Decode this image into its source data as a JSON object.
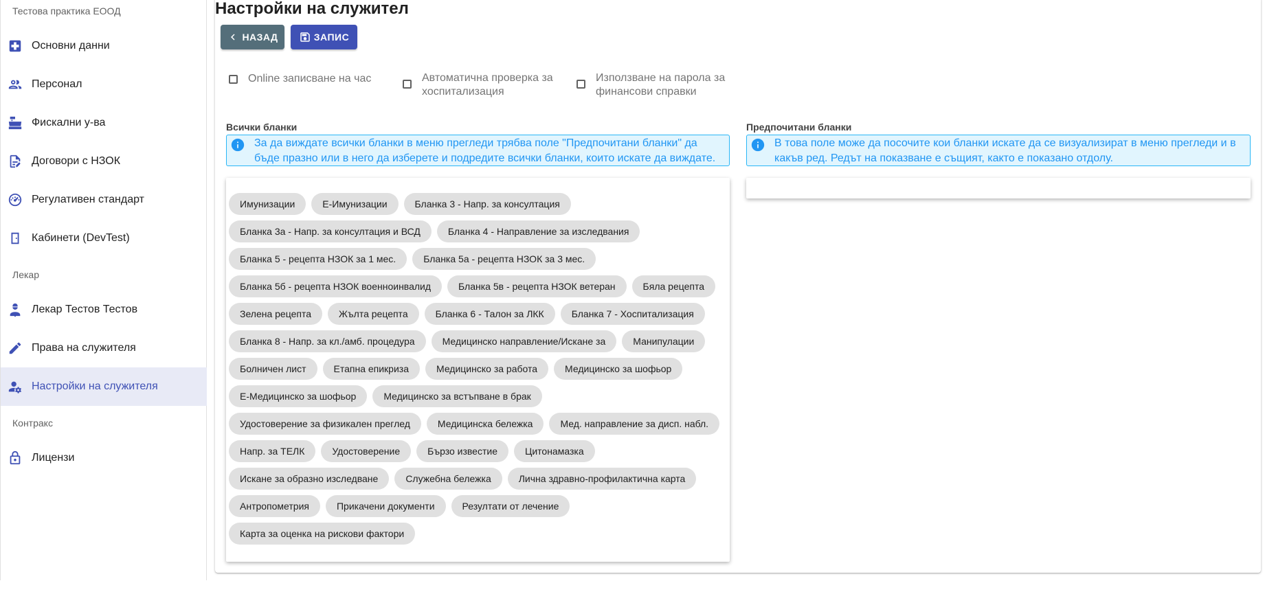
{
  "sidebar": {
    "sections": [
      {
        "label": "Тестова практика ЕООД"
      },
      {
        "label": "Лекар"
      },
      {
        "label": "Контракс"
      }
    ],
    "items": [
      {
        "label": "Основни данни",
        "icon": "medical-cross-icon"
      },
      {
        "label": "Персонал",
        "icon": "people-icon"
      },
      {
        "label": "Фискални у-ва",
        "icon": "cash-register-icon"
      },
      {
        "label": "Договори с НЗОК",
        "icon": "contract-icon"
      },
      {
        "label": "Регулативен стандарт",
        "icon": "gauge-icon"
      },
      {
        "label": "Кабинети (DevTest)",
        "icon": "door-icon"
      },
      {
        "label": "Лекар Тестов Тестов",
        "icon": "doctor-icon"
      },
      {
        "label": "Права на служителя",
        "icon": "pencil-icon"
      },
      {
        "label": "Настройки на служителя",
        "icon": "user-settings-icon",
        "active": true
      },
      {
        "label": "Лицензи",
        "icon": "lock-icon"
      }
    ]
  },
  "header": {
    "title": "Настройки на служител"
  },
  "toolbar": {
    "back_label": "НАЗАД",
    "save_label": "ЗАПИС"
  },
  "options": [
    {
      "label": "Online записване на час",
      "checked": false
    },
    {
      "label": "Автоматична проверка за\nхоспитализация",
      "checked": false
    },
    {
      "label": "Използване на парола за\nфинансови справки",
      "checked": false
    }
  ],
  "all_forms": {
    "title": "Всички бланки",
    "info": "За да виждате всички бланки в меню прегледи трябва поле \"Предпочитани бланки\" да бъде празно или в него да изберете и подредите всички бланки, които искате да виждате.",
    "chips": [
      "Имунизации",
      "Е-Имунизации",
      "Бланка 3 - Напр. за консултация",
      "Бланка 3а - Напр. за консултация и ВСД",
      "Бланка 4 - Направление за изследвания",
      "Бланка 5 - рецепта НЗОК за 1 мес.",
      "Бланка 5а - рецепта НЗОК за 3 мес.",
      "Бланка 5б - рецепта НЗОК военноинвалид",
      "Бланка 5в - рецепта НЗОК ветеран",
      "Бяла рецепта",
      "Зелена рецепта",
      "Жълта рецепта",
      "Бланка 6 - Талон за ЛКК",
      "Бланка 7 - Хоспитализация",
      "Бланка 8 - Напр. за кл./амб. процедура",
      "Медицинско направление/Искане за",
      "Манипулации",
      "Болничен лист",
      "Етапна епикриза",
      "Медицинско за работа",
      "Медицинско за шофьор",
      "Е-Медицинско за шофьор",
      "Медицинско за встъпване в брак",
      "Удостоверение за физикален преглед",
      "Медицинска бележка",
      "Мед. направление за дисп. набл.",
      "Напр. за ТЕЛК",
      "Удостоверение",
      "Бързо известие",
      "Цитонамазка",
      "Искане за образно изследване",
      "Служебна бележка",
      "Лична здравно-профилактична карта",
      "Антропометрия",
      "Прикачени документи",
      "Резултати от лечение",
      "Карта за оценка на рискови фактори"
    ]
  },
  "preferred_forms": {
    "title": "Предпочитани бланки",
    "info": "В това поле може да посочите кои бланки искате да се визуализират в меню прегледи и в какъв ред. Редът на показване е същият, както е показано отдолу.",
    "chips": []
  },
  "colors": {
    "primary": "#3f51b5",
    "back_button": "#546e7a",
    "info": "#2196f3",
    "info_bg": "#e1f5fe",
    "chip_bg": "#e0e0e0",
    "active_nav_bg": "#e8eaf6"
  }
}
